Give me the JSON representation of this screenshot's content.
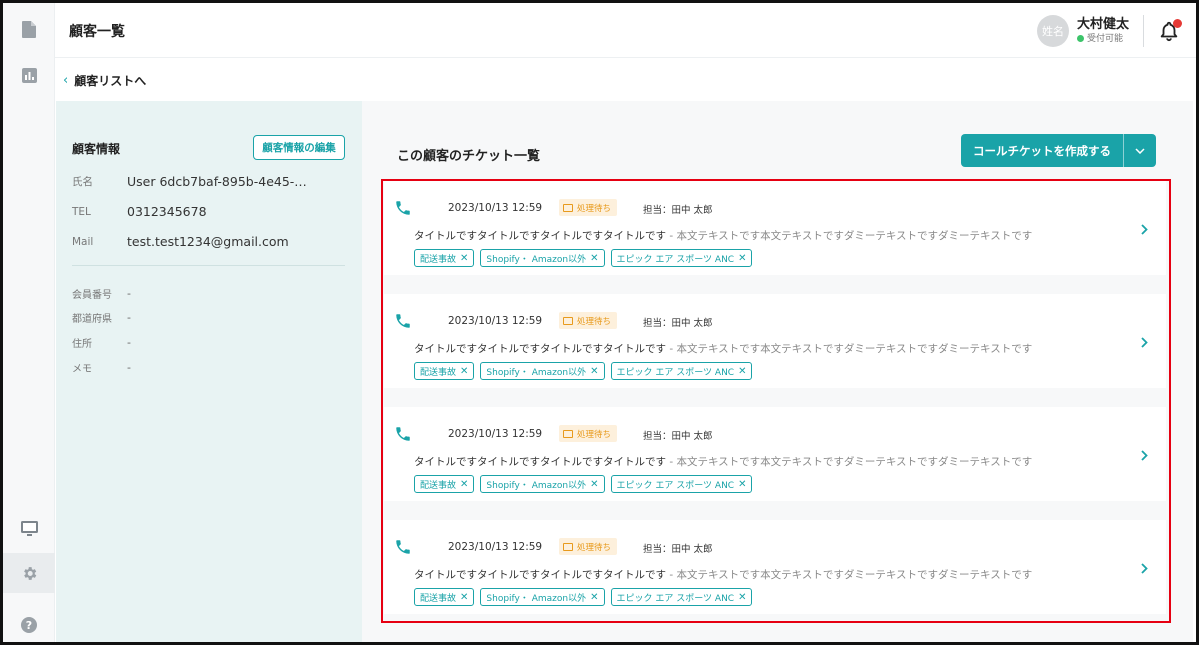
{
  "header": {
    "title": "顧客一覧",
    "avatar_text": "姓名",
    "user_name": "大村健太",
    "user_status": "受付可能"
  },
  "breadcrumb": {
    "label": "顧客リストへ"
  },
  "customer": {
    "section_title": "顧客情報",
    "edit_label": "顧客情報の編集",
    "fields": [
      {
        "label": "氏名",
        "value": "User 6dcb7baf-895b-4e45-…"
      },
      {
        "label": "TEL",
        "value": "0312345678"
      },
      {
        "label": "Mail",
        "value": "test.test1234@gmail.com"
      }
    ],
    "extra_fields": [
      {
        "label": "会員番号",
        "value": "-"
      },
      {
        "label": "都道府県",
        "value": "-"
      },
      {
        "label": "住所",
        "value": "-"
      },
      {
        "label": "メモ",
        "value": "-"
      }
    ]
  },
  "tickets": {
    "title": "この顧客のチケット一覧",
    "create_label": "コールチケットを作成する",
    "items": [
      {
        "date": "2023/10/13 12:59",
        "status": "処理待ち",
        "assignee": "担当：田中 太郎",
        "title": "タイトルですタイトルですタイトルですタイトルです",
        "body": " - 本文テキストです本文テキストですダミーテキストですダミーテキストです",
        "tags": [
          "配送事故",
          "Shopify・ Amazon以外",
          "エピック エア スポーツ ANC"
        ]
      },
      {
        "date": "2023/10/13 12:59",
        "status": "処理待ち",
        "assignee": "担当：田中 太郎",
        "title": "タイトルですタイトルですタイトルですタイトルです",
        "body": " - 本文テキストです本文テキストですダミーテキストですダミーテキストです",
        "tags": [
          "配送事故",
          "Shopify・ Amazon以外",
          "エピック エア スポーツ ANC"
        ]
      },
      {
        "date": "2023/10/13 12:59",
        "status": "処理待ち",
        "assignee": "担当：田中 太郎",
        "title": "タイトルですタイトルですタイトルですタイトルです",
        "body": " - 本文テキストです本文テキストですダミーテキストですダミーテキストです",
        "tags": [
          "配送事故",
          "Shopify・ Amazon以外",
          "エピック エア スポーツ ANC"
        ]
      },
      {
        "date": "2023/10/13 12:59",
        "status": "処理待ち",
        "assignee": "担当：田中 太郎",
        "title": "タイトルですタイトルですタイトルですタイトルです",
        "body": " - 本文テキストです本文テキストですダミーテキストですダミーテキストです",
        "tags": [
          "配送事故",
          "Shopify・ Amazon以外",
          "エピック エア スポーツ ANC"
        ]
      }
    ]
  },
  "colors": {
    "accent": "#1aa3a8",
    "status_pending": "#e89a1c",
    "highlight": "#e60012",
    "notification": "#e53935",
    "online": "#3cc46a"
  },
  "icons": {
    "rail": [
      "document-icon",
      "chart-icon",
      "monitor-icon",
      "gear-icon",
      "help-icon"
    ],
    "header": [
      "bell-icon"
    ],
    "ticket": [
      "phone-icon",
      "inbox-icon",
      "chevron-right-icon"
    ]
  }
}
